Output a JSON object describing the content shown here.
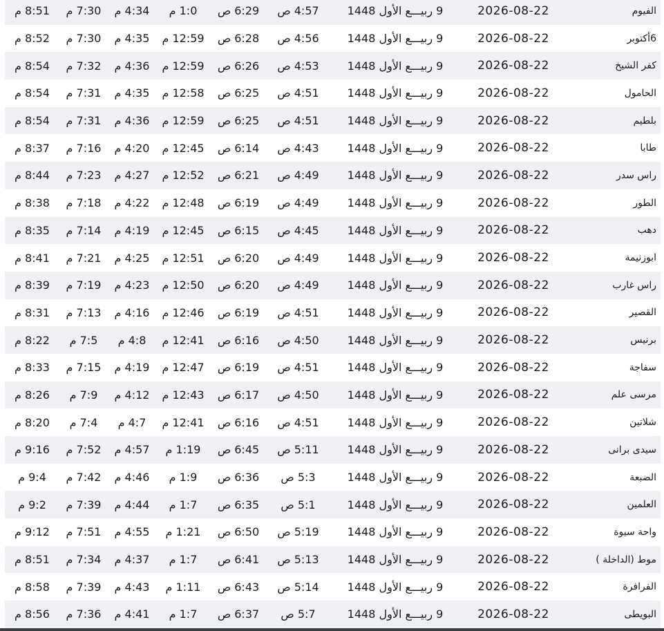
{
  "rows": [
    {
      "city": "الفيوم",
      "date": "2026-08-22",
      "hijri": "9 ربيـــع الأول 1448",
      "fajr": "4:57 ص",
      "sunrise": "6:29 ص",
      "dhuhr": "1:0 م",
      "asr": "4:34 م",
      "maghrib": "7:30 م",
      "isha": "8:51 م"
    },
    {
      "city": "6أكتوبر",
      "date": "2026-08-22",
      "hijri": "9 ربيـــع الأول 1448",
      "fajr": "4:56 ص",
      "sunrise": "6:28 ص",
      "dhuhr": "12:59 م",
      "asr": "4:35 م",
      "maghrib": "7:30 م",
      "isha": "8:52 م"
    },
    {
      "city": "كفر الشيخ",
      "date": "2026-08-22",
      "hijri": "9 ربيـــع الأول 1448",
      "fajr": "4:53 ص",
      "sunrise": "6:26 ص",
      "dhuhr": "12:59 م",
      "asr": "4:36 م",
      "maghrib": "7:32 م",
      "isha": "8:54 م"
    },
    {
      "city": "الحامول",
      "date": "2026-08-22",
      "hijri": "9 ربيـــع الأول 1448",
      "fajr": "4:51 ص",
      "sunrise": "6:25 ص",
      "dhuhr": "12:58 م",
      "asr": "4:35 م",
      "maghrib": "7:31 م",
      "isha": "8:54 م"
    },
    {
      "city": "بلطيم",
      "date": "2026-08-22",
      "hijri": "9 ربيـــع الأول 1448",
      "fajr": "4:51 ص",
      "sunrise": "6:25 ص",
      "dhuhr": "12:59 م",
      "asr": "4:36 م",
      "maghrib": "7:31 م",
      "isha": "8:54 م"
    },
    {
      "city": "طابا",
      "date": "2026-08-22",
      "hijri": "9 ربيـــع الأول 1448",
      "fajr": "4:43 ص",
      "sunrise": "6:14 ص",
      "dhuhr": "12:45 م",
      "asr": "4:20 م",
      "maghrib": "7:16 م",
      "isha": "8:37 م"
    },
    {
      "city": "راس سدر",
      "date": "2026-08-22",
      "hijri": "9 ربيـــع الأول 1448",
      "fajr": "4:49 ص",
      "sunrise": "6:21 ص",
      "dhuhr": "12:52 م",
      "asr": "4:27 م",
      "maghrib": "7:23 م",
      "isha": "8:44 م"
    },
    {
      "city": "الطور",
      "date": "2026-08-22",
      "hijri": "9 ربيـــع الأول 1448",
      "fajr": "4:49 ص",
      "sunrise": "6:19 ص",
      "dhuhr": "12:48 م",
      "asr": "4:22 م",
      "maghrib": "7:18 م",
      "isha": "8:38 م"
    },
    {
      "city": "دهب",
      "date": "2026-08-22",
      "hijri": "9 ربيـــع الأول 1448",
      "fajr": "4:45 ص",
      "sunrise": "6:15 ص",
      "dhuhr": "12:45 م",
      "asr": "4:19 م",
      "maghrib": "7:14 م",
      "isha": "8:35 م"
    },
    {
      "city": "ابوزنيمة",
      "date": "2026-08-22",
      "hijri": "9 ربيـــع الأول 1448",
      "fajr": "4:49 ص",
      "sunrise": "6:20 ص",
      "dhuhr": "12:51 م",
      "asr": "4:25 م",
      "maghrib": "7:21 م",
      "isha": "8:41 م"
    },
    {
      "city": "راس غارب",
      "date": "2026-08-22",
      "hijri": "9 ربيـــع الأول 1448",
      "fajr": "4:49 ص",
      "sunrise": "6:20 ص",
      "dhuhr": "12:50 م",
      "asr": "4:23 م",
      "maghrib": "7:19 م",
      "isha": "8:39 م"
    },
    {
      "city": "القصير",
      "date": "2026-08-22",
      "hijri": "9 ربيـــع الأول 1448",
      "fajr": "4:51 ص",
      "sunrise": "6:19 ص",
      "dhuhr": "12:46 م",
      "asr": "4:16 م",
      "maghrib": "7:13 م",
      "isha": "8:31 م"
    },
    {
      "city": "برنيس",
      "date": "2026-08-22",
      "hijri": "9 ربيـــع الأول 1448",
      "fajr": "4:50 ص",
      "sunrise": "6:16 ص",
      "dhuhr": "12:41 م",
      "asr": "4:8 م",
      "maghrib": "7:5 م",
      "isha": "8:22 م"
    },
    {
      "city": "سفاجة",
      "date": "2026-08-22",
      "hijri": "9 ربيـــع الأول 1448",
      "fajr": "4:51 ص",
      "sunrise": "6:19 ص",
      "dhuhr": "12:47 م",
      "asr": "4:19 م",
      "maghrib": "7:15 م",
      "isha": "8:33 م"
    },
    {
      "city": "مرسى علم",
      "date": "2026-08-22",
      "hijri": "9 ربيـــع الأول 1448",
      "fajr": "4:50 ص",
      "sunrise": "6:17 ص",
      "dhuhr": "12:43 م",
      "asr": "4:12 م",
      "maghrib": "7:9 م",
      "isha": "8:26 م"
    },
    {
      "city": "شلاتين",
      "date": "2026-08-22",
      "hijri": "9 ربيـــع الأول 1448",
      "fajr": "4:51 ص",
      "sunrise": "6:16 ص",
      "dhuhr": "12:41 م",
      "asr": "4:7 م",
      "maghrib": "7:4 م",
      "isha": "8:20 م"
    },
    {
      "city": "سيدى برانى",
      "date": "2026-08-22",
      "hijri": "9 ربيـــع الأول 1448",
      "fajr": "5:11 ص",
      "sunrise": "6:45 ص",
      "dhuhr": "1:19 م",
      "asr": "4:57 م",
      "maghrib": "7:52 م",
      "isha": "9:16 م"
    },
    {
      "city": "الضبعة",
      "date": "2026-08-22",
      "hijri": "9 ربيـــع الأول 1448",
      "fajr": "5:3 ص",
      "sunrise": "6:36 ص",
      "dhuhr": "1:9 م",
      "asr": "4:46 م",
      "maghrib": "7:42 م",
      "isha": "9:4 م"
    },
    {
      "city": "العلمين",
      "date": "2026-08-22",
      "hijri": "9 ربيـــع الأول 1448",
      "fajr": "5:1 ص",
      "sunrise": "6:35 ص",
      "dhuhr": "1:7 م",
      "asr": "4:44 م",
      "maghrib": "7:39 م",
      "isha": "9:2 م"
    },
    {
      "city": "واحة سيوة",
      "date": "2026-08-22",
      "hijri": "9 ربيـــع الأول 1448",
      "fajr": "5:19 ص",
      "sunrise": "6:50 ص",
      "dhuhr": "1:21 م",
      "asr": "4:55 م",
      "maghrib": "7:51 م",
      "isha": "9:12 م"
    },
    {
      "city": "موط (الداخلة )",
      "date": "2026-08-22",
      "hijri": "9 ربيـــع الأول 1448",
      "fajr": "5:13 ص",
      "sunrise": "6:41 ص",
      "dhuhr": "1:7 م",
      "asr": "4:37 م",
      "maghrib": "7:34 م",
      "isha": "8:51 م"
    },
    {
      "city": "الفرافرة",
      "date": "2026-08-22",
      "hijri": "9 ربيـــع الأول 1448",
      "fajr": "5:14 ص",
      "sunrise": "6:43 ص",
      "dhuhr": "1:11 م",
      "asr": "4:43 م",
      "maghrib": "7:39 م",
      "isha": "8:58 م"
    },
    {
      "city": "البويطى",
      "date": "2026-08-22",
      "hijri": "9 ربيـــع الأول 1448",
      "fajr": "5:7 ص",
      "sunrise": "6:37 ص",
      "dhuhr": "1:7 م",
      "asr": "4:41 م",
      "maghrib": "7:36 م",
      "isha": "8:56 م"
    }
  ]
}
